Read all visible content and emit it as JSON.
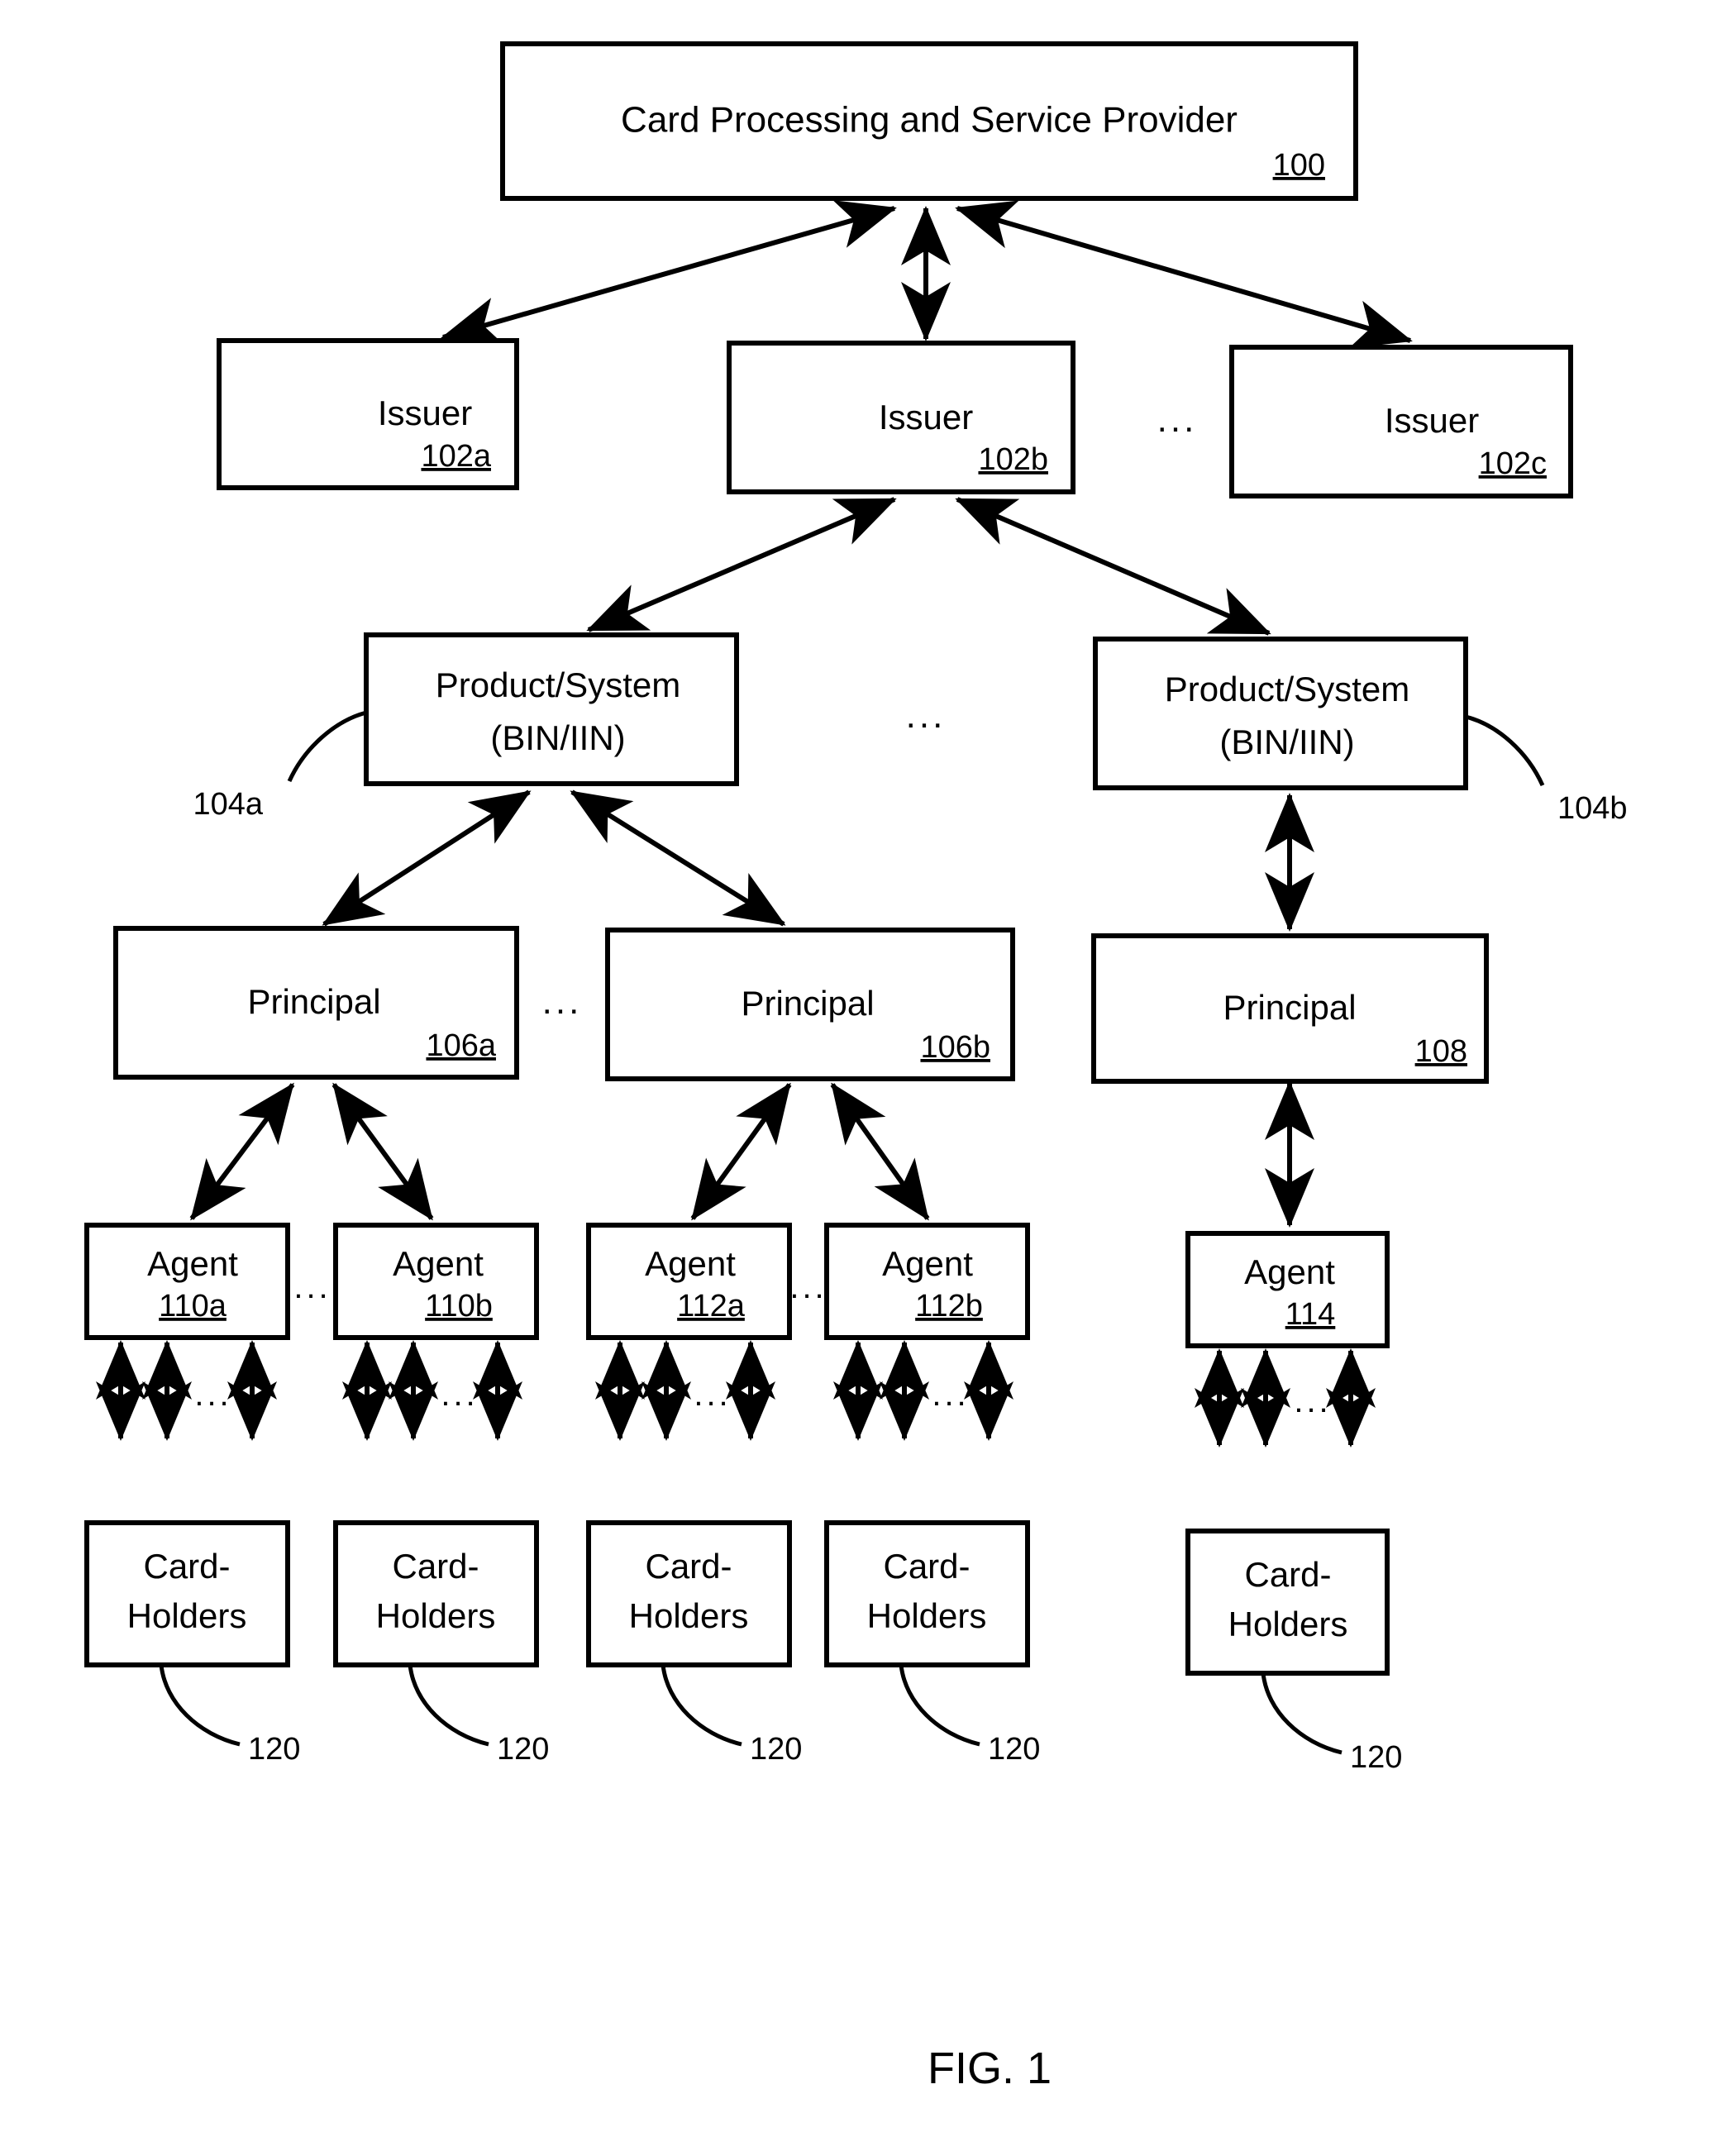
{
  "figure": {
    "caption": "FIG. 1",
    "title_box": {
      "label": "Card Processing and Service Provider",
      "ref": "100"
    }
  },
  "nodes": {
    "issuers": [
      {
        "label": "Issuer",
        "ref": "102a"
      },
      {
        "label": "Issuer",
        "ref": "102b"
      },
      {
        "label": "Issuer",
        "ref": "102c"
      }
    ],
    "products": [
      {
        "line1": "Product/System",
        "line2": "(BIN/IIN)",
        "ref": "104a"
      },
      {
        "line1": "Product/System",
        "line2": "(BIN/IIN)",
        "ref": "104b"
      }
    ],
    "principals": [
      {
        "label": "Principal",
        "ref": "106a"
      },
      {
        "label": "Principal",
        "ref": "106b"
      },
      {
        "label": "Principal",
        "ref": "108"
      }
    ],
    "agents": [
      {
        "label": "Agent",
        "ref": "110a"
      },
      {
        "label": "Agent",
        "ref": "110b"
      },
      {
        "label": "Agent",
        "ref": "112a"
      },
      {
        "label": "Agent",
        "ref": "112b"
      },
      {
        "label": "Agent",
        "ref": "114"
      }
    ],
    "cardholders": [
      {
        "line1": "Card-",
        "line2": "Holders",
        "ref": "120"
      },
      {
        "line1": "Card-",
        "line2": "Holders",
        "ref": "120"
      },
      {
        "line1": "Card-",
        "line2": "Holders",
        "ref": "120"
      },
      {
        "line1": "Card-",
        "line2": "Holders",
        "ref": "120"
      },
      {
        "line1": "Card-",
        "line2": "Holders",
        "ref": "120"
      }
    ]
  },
  "ellipsis": {
    "glyph": "...",
    "issuer_row": "...",
    "product_row": "...",
    "principal_row": "...",
    "agent_row_a": "...",
    "agent_row_b": "...",
    "cardholder_link_1": "...",
    "cardholder_link_2": "...",
    "cardholder_link_3": "...",
    "cardholder_link_4": "...",
    "cardholder_link_5": "..."
  },
  "colors": {
    "stroke": "#000000",
    "fill": "#ffffff",
    "text": "#000000"
  }
}
